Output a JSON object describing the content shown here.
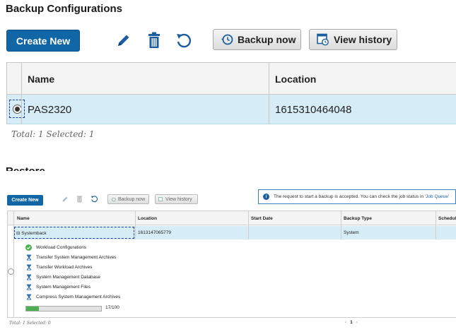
{
  "top": {
    "title": "Backup Configurations",
    "toolbar": {
      "create_label": "Create New",
      "backup_now_label": "Backup now",
      "view_history_label": "View history"
    },
    "columns": [
      "Name",
      "Location"
    ],
    "rows": [
      {
        "name": "PAS2320",
        "location": "1615310464048",
        "selected": true
      }
    ],
    "total_text": "Total: 1 Selected: 1",
    "next_section_title": "Restore"
  },
  "bottom": {
    "toolbar": {
      "create_label": "Create New",
      "backup_now_label": "Backup now",
      "view_history_label": "View history"
    },
    "notice": {
      "text": "The request to start a backup is accepted. You can check the job status in '",
      "link": "Job Queue",
      "suffix": "'"
    },
    "columns": [
      "Name",
      "Location",
      "Start Date",
      "Backup Type",
      "Schedule"
    ],
    "row": {
      "name": "⊟ Systemback",
      "location": "1613147065779",
      "start_date": "",
      "backup_type": "System"
    },
    "steps": [
      {
        "label": "Workload Configurations",
        "status": "done"
      },
      {
        "label": "Transfer System Management Archives",
        "status": "pending"
      },
      {
        "label": "Transfer Workload Archives",
        "status": "pending"
      },
      {
        "label": "System Management Database",
        "status": "pending"
      },
      {
        "label": "System Management Files",
        "status": "pending"
      },
      {
        "label": "Compress System Management Archives",
        "status": "pending"
      }
    ],
    "progress": {
      "value": 17,
      "max": 100,
      "text": "17/100"
    },
    "total_text": "Total: 1 Selected: 0",
    "pager": {
      "prev": "‹",
      "current": "1",
      "next": "›"
    }
  },
  "colors": {
    "primary_button": "#1166a6",
    "selected_row": "#d6ecf6",
    "icon_blue": "#1c5e9f",
    "success_green": "#4caf50"
  },
  "icons": [
    "edit-icon",
    "delete-icon",
    "undo-icon",
    "backup-now-icon",
    "view-history-icon",
    "info-icon",
    "check-circle-icon",
    "hourglass-icon"
  ]
}
